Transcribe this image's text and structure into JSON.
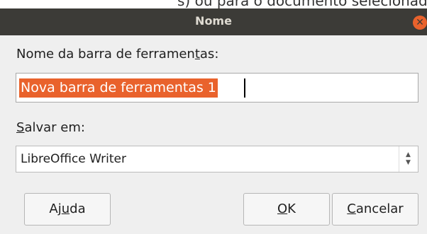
{
  "background_text": "s) ou para o documento selecionado. Quando",
  "window": {
    "title": "Nome"
  },
  "dialog": {
    "name_label_pre": "Nome da barra de ferramen",
    "name_label_accel": "t",
    "name_label_post": "as:",
    "name_value": "Nova barra de ferramentas 1",
    "save_label_accel": "S",
    "save_label_post": "alvar em:",
    "save_value": "LibreOffice Writer"
  },
  "buttons": {
    "help_pre": "Aj",
    "help_accel": "u",
    "help_post": "da",
    "ok_accel": "O",
    "ok_post": "K",
    "cancel_accel": "C",
    "cancel_post": "ancelar"
  },
  "colors": {
    "selection": "#e9622c",
    "titlebar": "#3c3b37",
    "close_button": "#e9622c"
  }
}
